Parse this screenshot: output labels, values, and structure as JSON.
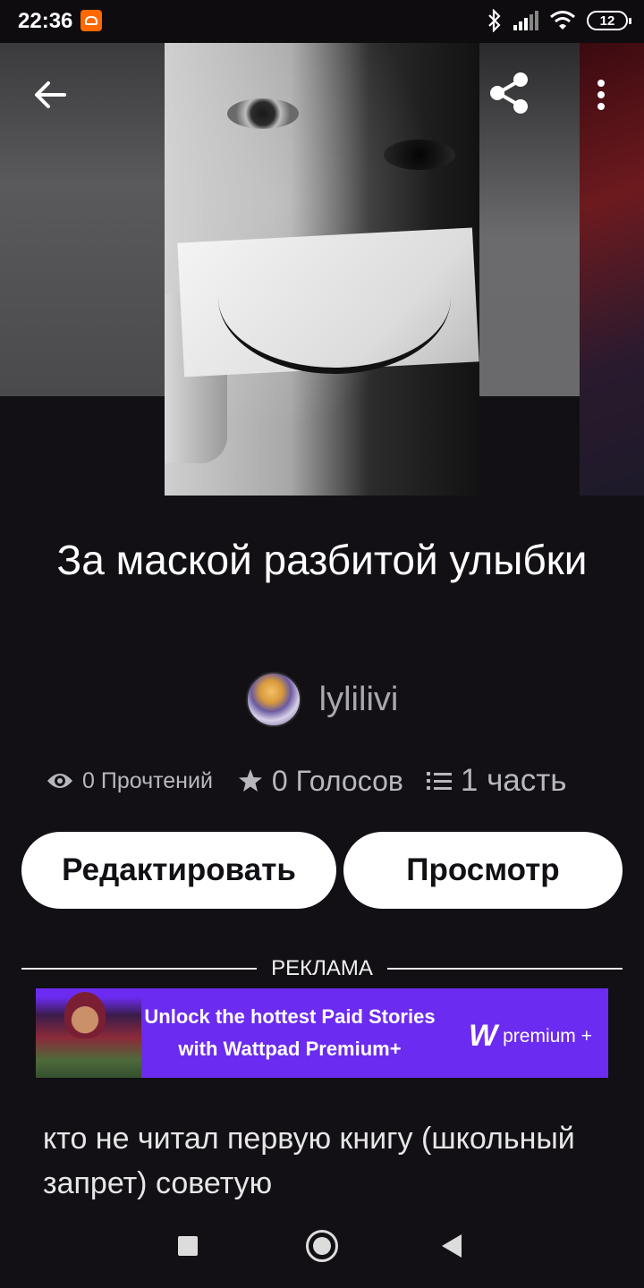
{
  "status_bar": {
    "time": "22:36",
    "battery": "12"
  },
  "toolbar": {
    "back_icon": "arrow-left-icon",
    "share_icon": "share-icon",
    "more_icon": "more-vertical-icon"
  },
  "story": {
    "title": "За маской разбитой улыбки",
    "author": "lylilivi",
    "reads": "0 Прочтений",
    "votes": "0 Голосов",
    "parts": "1 часть",
    "description": "кто не читал первую книгу (школьный запрет) советую"
  },
  "actions": {
    "edit_label": "Редактировать",
    "view_label": "Просмотр"
  },
  "ad": {
    "label": "РЕКЛАМА",
    "line1": "Unlock the hottest Paid Stories",
    "line2": "with Wattpad Premium+",
    "brand_mark": "W",
    "brand_text": "premium +",
    "color": "#6b2bf0"
  },
  "nav": {
    "recent_icon": "square-icon",
    "home_icon": "circle-icon",
    "back_icon": "triangle-back-icon"
  }
}
